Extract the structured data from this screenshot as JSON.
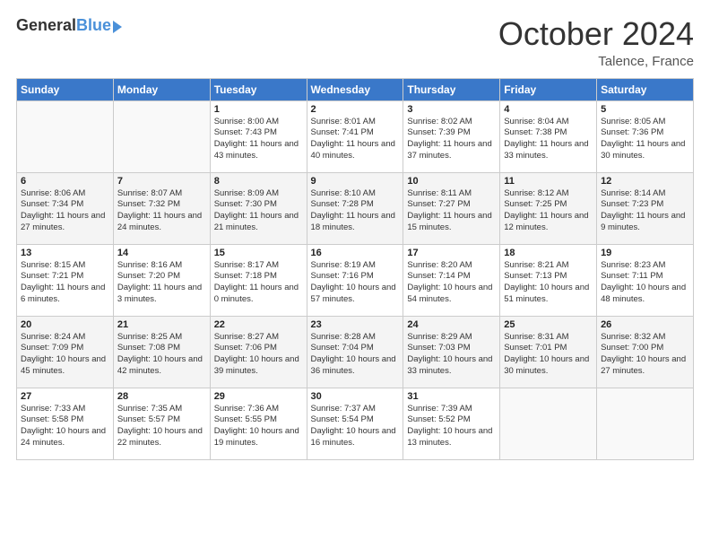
{
  "logo": {
    "general": "General",
    "blue": "Blue"
  },
  "header": {
    "month": "October 2024",
    "location": "Talence, France"
  },
  "weekdays": [
    "Sunday",
    "Monday",
    "Tuesday",
    "Wednesday",
    "Thursday",
    "Friday",
    "Saturday"
  ],
  "weeks": [
    [
      {
        "day": "",
        "sunrise": "",
        "sunset": "",
        "daylight": ""
      },
      {
        "day": "",
        "sunrise": "",
        "sunset": "",
        "daylight": ""
      },
      {
        "day": "1",
        "sunrise": "Sunrise: 8:00 AM",
        "sunset": "Sunset: 7:43 PM",
        "daylight": "Daylight: 11 hours and 43 minutes."
      },
      {
        "day": "2",
        "sunrise": "Sunrise: 8:01 AM",
        "sunset": "Sunset: 7:41 PM",
        "daylight": "Daylight: 11 hours and 40 minutes."
      },
      {
        "day": "3",
        "sunrise": "Sunrise: 8:02 AM",
        "sunset": "Sunset: 7:39 PM",
        "daylight": "Daylight: 11 hours and 37 minutes."
      },
      {
        "day": "4",
        "sunrise": "Sunrise: 8:04 AM",
        "sunset": "Sunset: 7:38 PM",
        "daylight": "Daylight: 11 hours and 33 minutes."
      },
      {
        "day": "5",
        "sunrise": "Sunrise: 8:05 AM",
        "sunset": "Sunset: 7:36 PM",
        "daylight": "Daylight: 11 hours and 30 minutes."
      }
    ],
    [
      {
        "day": "6",
        "sunrise": "Sunrise: 8:06 AM",
        "sunset": "Sunset: 7:34 PM",
        "daylight": "Daylight: 11 hours and 27 minutes."
      },
      {
        "day": "7",
        "sunrise": "Sunrise: 8:07 AM",
        "sunset": "Sunset: 7:32 PM",
        "daylight": "Daylight: 11 hours and 24 minutes."
      },
      {
        "day": "8",
        "sunrise": "Sunrise: 8:09 AM",
        "sunset": "Sunset: 7:30 PM",
        "daylight": "Daylight: 11 hours and 21 minutes."
      },
      {
        "day": "9",
        "sunrise": "Sunrise: 8:10 AM",
        "sunset": "Sunset: 7:28 PM",
        "daylight": "Daylight: 11 hours and 18 minutes."
      },
      {
        "day": "10",
        "sunrise": "Sunrise: 8:11 AM",
        "sunset": "Sunset: 7:27 PM",
        "daylight": "Daylight: 11 hours and 15 minutes."
      },
      {
        "day": "11",
        "sunrise": "Sunrise: 8:12 AM",
        "sunset": "Sunset: 7:25 PM",
        "daylight": "Daylight: 11 hours and 12 minutes."
      },
      {
        "day": "12",
        "sunrise": "Sunrise: 8:14 AM",
        "sunset": "Sunset: 7:23 PM",
        "daylight": "Daylight: 11 hours and 9 minutes."
      }
    ],
    [
      {
        "day": "13",
        "sunrise": "Sunrise: 8:15 AM",
        "sunset": "Sunset: 7:21 PM",
        "daylight": "Daylight: 11 hours and 6 minutes."
      },
      {
        "day": "14",
        "sunrise": "Sunrise: 8:16 AM",
        "sunset": "Sunset: 7:20 PM",
        "daylight": "Daylight: 11 hours and 3 minutes."
      },
      {
        "day": "15",
        "sunrise": "Sunrise: 8:17 AM",
        "sunset": "Sunset: 7:18 PM",
        "daylight": "Daylight: 11 hours and 0 minutes."
      },
      {
        "day": "16",
        "sunrise": "Sunrise: 8:19 AM",
        "sunset": "Sunset: 7:16 PM",
        "daylight": "Daylight: 10 hours and 57 minutes."
      },
      {
        "day": "17",
        "sunrise": "Sunrise: 8:20 AM",
        "sunset": "Sunset: 7:14 PM",
        "daylight": "Daylight: 10 hours and 54 minutes."
      },
      {
        "day": "18",
        "sunrise": "Sunrise: 8:21 AM",
        "sunset": "Sunset: 7:13 PM",
        "daylight": "Daylight: 10 hours and 51 minutes."
      },
      {
        "day": "19",
        "sunrise": "Sunrise: 8:23 AM",
        "sunset": "Sunset: 7:11 PM",
        "daylight": "Daylight: 10 hours and 48 minutes."
      }
    ],
    [
      {
        "day": "20",
        "sunrise": "Sunrise: 8:24 AM",
        "sunset": "Sunset: 7:09 PM",
        "daylight": "Daylight: 10 hours and 45 minutes."
      },
      {
        "day": "21",
        "sunrise": "Sunrise: 8:25 AM",
        "sunset": "Sunset: 7:08 PM",
        "daylight": "Daylight: 10 hours and 42 minutes."
      },
      {
        "day": "22",
        "sunrise": "Sunrise: 8:27 AM",
        "sunset": "Sunset: 7:06 PM",
        "daylight": "Daylight: 10 hours and 39 minutes."
      },
      {
        "day": "23",
        "sunrise": "Sunrise: 8:28 AM",
        "sunset": "Sunset: 7:04 PM",
        "daylight": "Daylight: 10 hours and 36 minutes."
      },
      {
        "day": "24",
        "sunrise": "Sunrise: 8:29 AM",
        "sunset": "Sunset: 7:03 PM",
        "daylight": "Daylight: 10 hours and 33 minutes."
      },
      {
        "day": "25",
        "sunrise": "Sunrise: 8:31 AM",
        "sunset": "Sunset: 7:01 PM",
        "daylight": "Daylight: 10 hours and 30 minutes."
      },
      {
        "day": "26",
        "sunrise": "Sunrise: 8:32 AM",
        "sunset": "Sunset: 7:00 PM",
        "daylight": "Daylight: 10 hours and 27 minutes."
      }
    ],
    [
      {
        "day": "27",
        "sunrise": "Sunrise: 7:33 AM",
        "sunset": "Sunset: 5:58 PM",
        "daylight": "Daylight: 10 hours and 24 minutes."
      },
      {
        "day": "28",
        "sunrise": "Sunrise: 7:35 AM",
        "sunset": "Sunset: 5:57 PM",
        "daylight": "Daylight: 10 hours and 22 minutes."
      },
      {
        "day": "29",
        "sunrise": "Sunrise: 7:36 AM",
        "sunset": "Sunset: 5:55 PM",
        "daylight": "Daylight: 10 hours and 19 minutes."
      },
      {
        "day": "30",
        "sunrise": "Sunrise: 7:37 AM",
        "sunset": "Sunset: 5:54 PM",
        "daylight": "Daylight: 10 hours and 16 minutes."
      },
      {
        "day": "31",
        "sunrise": "Sunrise: 7:39 AM",
        "sunset": "Sunset: 5:52 PM",
        "daylight": "Daylight: 10 hours and 13 minutes."
      },
      {
        "day": "",
        "sunrise": "",
        "sunset": "",
        "daylight": ""
      },
      {
        "day": "",
        "sunrise": "",
        "sunset": "",
        "daylight": ""
      }
    ]
  ]
}
